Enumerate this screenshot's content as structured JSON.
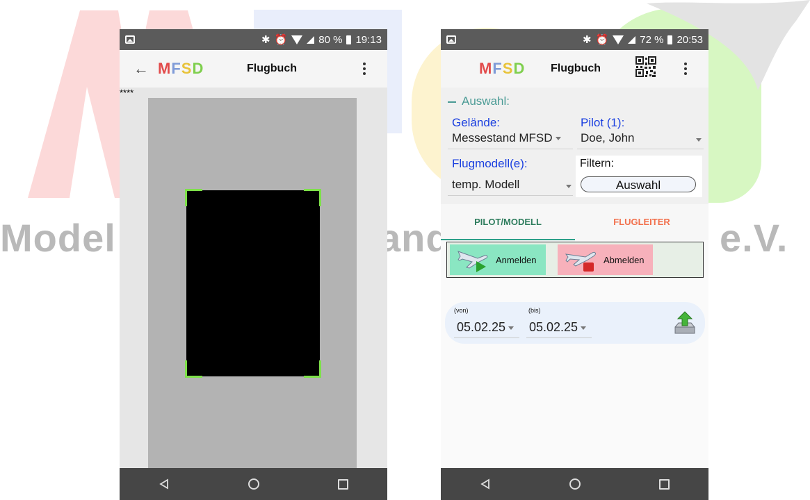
{
  "watermark": {
    "left_text": "Model",
    "middle_text": "and",
    "right_text": "e.V."
  },
  "left_phone": {
    "status": {
      "percent": "80 %",
      "time": "19:13"
    },
    "appbar": {
      "logo": [
        "M",
        "F",
        "S",
        "D"
      ],
      "title": "Flugbuch"
    },
    "scan": {
      "masked_text": "****"
    }
  },
  "right_phone": {
    "status": {
      "percent": "72 %",
      "time": "20:53"
    },
    "appbar": {
      "logo": [
        "M",
        "F",
        "S",
        "D"
      ],
      "title": "Flugbuch"
    },
    "selection": {
      "header": "Auswahl:",
      "gelaende_label": "Gelände:",
      "gelaende_value": "Messestand MFSD",
      "pilot_label": "Pilot (1):",
      "pilot_value": "Doe, John",
      "flugmodell_label": "Flugmodell(e):",
      "flugmodell_value": "temp. Modell",
      "filter_label": "Filtern:",
      "filter_button": "Auswahl"
    },
    "tabs": [
      {
        "label": "PILOT/MODELL",
        "active": true
      },
      {
        "label": "FLUGLEITER",
        "active": false
      }
    ],
    "actions": {
      "anmelden": "Anmelden",
      "abmelden": "Abmelden"
    },
    "dates": {
      "from_caption": "(von)",
      "from_value": "05.02.25",
      "to_caption": "(bis)",
      "to_value": "05.02.25"
    }
  },
  "colors": {
    "logo_m": "#e24b4b",
    "logo_f": "#7f9bd8",
    "logo_s": "#e8c33a",
    "logo_d": "#7fcf4e",
    "tab_active": "#2f7d5e",
    "tab_inactive": "#f2704c",
    "label_blue": "#1a3fe0",
    "anmelden_bg": "#8ae6c2",
    "abmelden_bg": "#f7b1bb"
  }
}
